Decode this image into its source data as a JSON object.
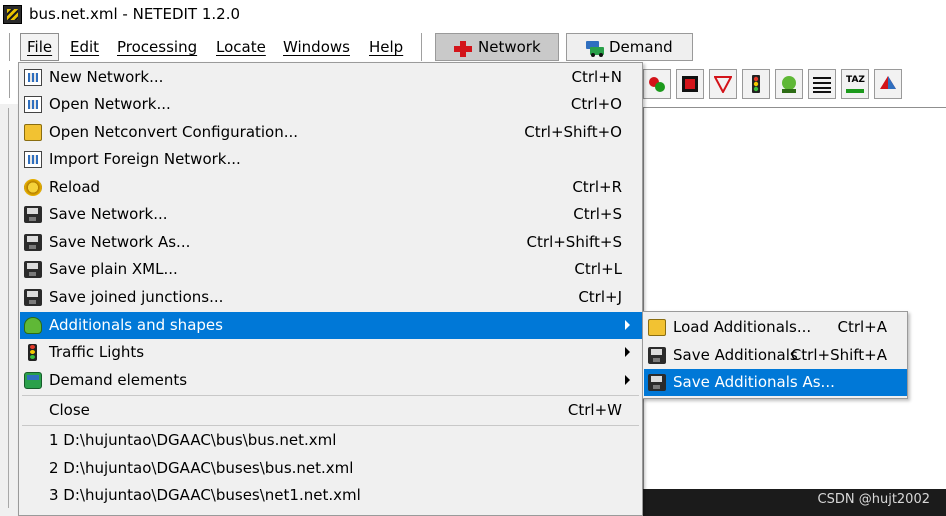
{
  "window": {
    "title": "bus.net.xml - NETEDIT 1.2.0"
  },
  "menubar": {
    "items": [
      "File",
      "Edit",
      "Processing",
      "Locate",
      "Windows",
      "Help"
    ],
    "modes": {
      "network": "Network",
      "demand": "Demand"
    }
  },
  "file_menu": {
    "items": [
      {
        "label": "New Network...",
        "shortcut": "Ctrl+N",
        "icon": "new-network-icon"
      },
      {
        "label": "Open Network...",
        "shortcut": "Ctrl+O",
        "icon": "open-network-icon"
      },
      {
        "label": "Open Netconvert Configuration...",
        "shortcut": "Ctrl+Shift+O",
        "icon": "open-folder-icon"
      },
      {
        "label": "Import Foreign Network...",
        "shortcut": "",
        "icon": "import-network-icon"
      },
      {
        "label": "Reload",
        "shortcut": "Ctrl+R",
        "icon": "reload-icon"
      },
      {
        "label": "Save Network...",
        "shortcut": "Ctrl+S",
        "icon": "save-icon"
      },
      {
        "label": "Save Network As...",
        "shortcut": "Ctrl+Shift+S",
        "icon": "save-icon"
      },
      {
        "label": "Save plain XML...",
        "shortcut": "Ctrl+L",
        "icon": "save-icon"
      },
      {
        "label": "Save joined junctions...",
        "shortcut": "Ctrl+J",
        "icon": "save-icon"
      },
      {
        "label": "Additionals and shapes",
        "shortcut": "",
        "icon": "additionals-icon",
        "highlighted": true,
        "submenu": true
      },
      {
        "label": "Traffic Lights",
        "shortcut": "",
        "icon": "traffic-light-icon",
        "submenu": true
      },
      {
        "label": "Demand elements",
        "shortcut": "",
        "icon": "demand-icon",
        "submenu": true
      },
      {
        "label": "Close",
        "shortcut": "Ctrl+W",
        "icon": ""
      }
    ],
    "recent": [
      "1 D:\\hujuntao\\DGAAC\\bus\\bus.net.xml",
      "2 D:\\hujuntao\\DGAAC\\buses\\bus.net.xml",
      "3 D:\\hujuntao\\DGAAC\\buses\\net1.net.xml"
    ]
  },
  "submenu": {
    "items": [
      {
        "label": "Load Additionals...",
        "shortcut": "Ctrl+A",
        "icon": "open-folder-icon"
      },
      {
        "label": "Save Additionals",
        "shortcut": "Ctrl+Shift+A",
        "icon": "save-icon"
      },
      {
        "label": "Save Additionals As...",
        "shortcut": "",
        "icon": "save-icon",
        "highlighted": true
      }
    ]
  },
  "toolbar": {
    "icons": [
      "junction-icon",
      "lane-icon",
      "prohibition-icon",
      "traffic-light-icon",
      "additional-icon",
      "wire-icon",
      "taz-icon",
      "polygon-icon"
    ],
    "taz_label": "TAZ"
  },
  "watermark": "CSDN @hujt2002",
  "colors": {
    "highlight": "#0078d7",
    "menu_bg": "#f0f0f0"
  }
}
